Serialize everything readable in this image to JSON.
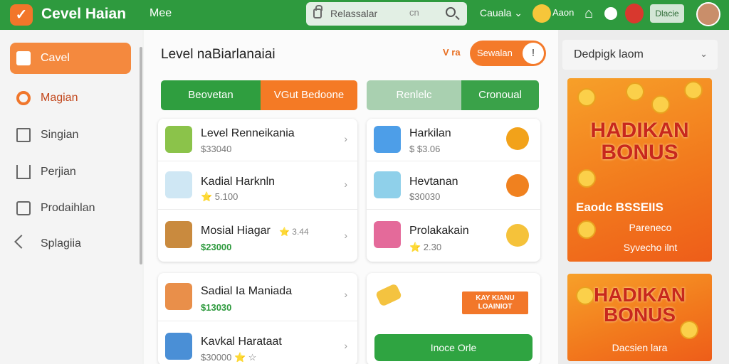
{
  "header": {
    "app_title": "Cevel Haian",
    "nav_link": "Mee",
    "search_placeholder": "Relassalar",
    "search_hint": "cn",
    "language": "Cauala ⌄",
    "user_name": "Aaon",
    "top_button": "Dlacie"
  },
  "sidebar": {
    "items": [
      {
        "label": "Cavel",
        "icon": "home-icon"
      },
      {
        "label": "Magian",
        "icon": "gear-icon"
      },
      {
        "label": "Singian",
        "icon": "box-icon"
      },
      {
        "label": "Perjian",
        "icon": "house-icon"
      },
      {
        "label": "Prodaihlan",
        "icon": "document-icon"
      },
      {
        "label": "Splagiia",
        "icon": "arrow-icon"
      }
    ]
  },
  "main": {
    "title": "Level naBiarlanaiai",
    "title_meta": "V  ra",
    "toggle_label": "Sewalan",
    "toggle_knob": "!",
    "seg_left": {
      "a": "Beovetan",
      "b": "VGut Bedoone"
    },
    "seg_right": {
      "a": "Renlelc",
      "b": "Cronoual"
    },
    "left_list": [
      {
        "name": "Level Renneikania",
        "price": "$33040",
        "rating": ""
      },
      {
        "name": "Kadial Harknln",
        "price": "⭐ 5.100",
        "rating": ""
      },
      {
        "name": "Mosial Hiagar",
        "price": "$23000",
        "rating": "⭐ 3.44"
      }
    ],
    "right_list": [
      {
        "name": "Harkilan",
        "price": "$ $3.06"
      },
      {
        "name": "Hevtanan",
        "price": "$30030"
      },
      {
        "name": "Prolakakain",
        "price": "⭐ 2.30"
      }
    ],
    "left_list2": [
      {
        "name": "Sadial Ia Maniada",
        "price": "$13030"
      },
      {
        "name": "Kavkal Harataat",
        "price": "$30000 ⭐ ☆"
      }
    ],
    "promo_chip": "KAY KIANU\nLOAINIOT",
    "green_button": "Inoce Orle"
  },
  "right": {
    "dropdown_label": "Dedpigk laom",
    "banner1": {
      "big": "HADIKAN\nBONUS",
      "sub1": "Eaodc BSSEIIS",
      "sub2a": "Pareneco",
      "sub2b": "Syvecho ilnt"
    },
    "banner2": {
      "big": "HADIKAN\nBONUS",
      "sub": "Dacsien lara"
    }
  },
  "colors": {
    "brand_green": "#2e9a3e",
    "accent_orange": "#f2762a"
  }
}
